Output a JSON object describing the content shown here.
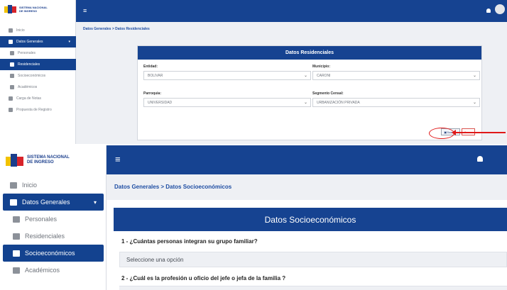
{
  "app": {
    "name_line1": "SISTEMA NACIONAL",
    "name_line2": "DE INGRESO",
    "brand_color": "#164391"
  },
  "shot1": {
    "sidebar": {
      "inicio": "Inicio",
      "datos_generales": "Datos Generales",
      "personales": "Personales",
      "residenciales": "Residenciales",
      "socioeconomicos": "Socioeconómicos",
      "academicos": "Académicos",
      "carga_notas": "Carga de Notas",
      "propuesta_registro": "Propuesta de Registro"
    },
    "breadcrumb": "Datos Generales  >  Datos Residenciales",
    "card_title": "Datos Residenciales",
    "fields": {
      "entidad": {
        "label": "Entidad:",
        "value": "BOLIVAR"
      },
      "municipio": {
        "label": "Municipio:",
        "value": "CARONI"
      },
      "parroquia": {
        "label": "Parroquia:",
        "value": "UNIVERSIDAD"
      },
      "segmento": {
        "label": "Segmento Censal:",
        "value": "URBANIZACIÓN PRIVADA"
      }
    },
    "buttons": {
      "guardar": "Guardar",
      "cerrar": "Cerrar"
    }
  },
  "shot2": {
    "sidebar": {
      "inicio": "Inicio",
      "datos_generales": "Datos Generales",
      "personales": "Personales",
      "residenciales": "Residenciales",
      "socioeconomicos": "Socioeconómicos",
      "academicos": "Académicos"
    },
    "breadcrumb": "Datos Generales  >  Datos Socioeconómicos",
    "card_title": "Datos Socioeconómicos",
    "q1": "1 - ¿Cuántas personas integran su grupo familiar?",
    "q1_placeholder": "Seleccione una opción",
    "q2": "2 - ¿Cuál es la profesión u oficio del jefe o jefa de la familia ?"
  }
}
